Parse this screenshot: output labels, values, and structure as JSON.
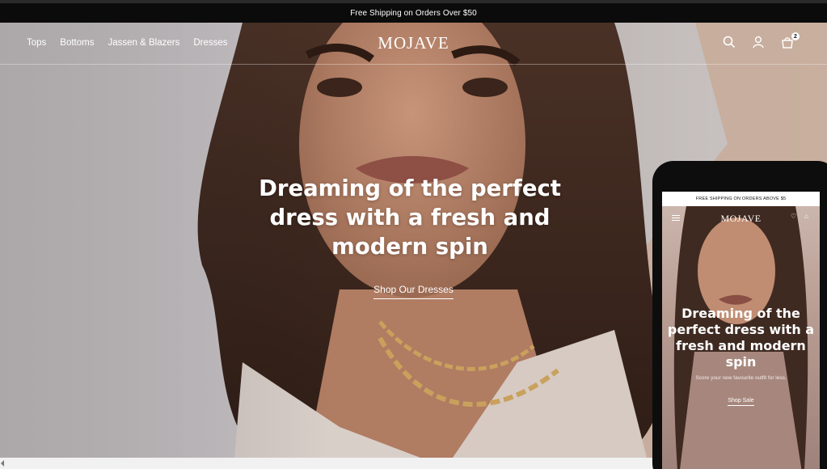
{
  "announcement": {
    "text": "Free Shipping on Orders Over $50"
  },
  "header": {
    "brand": "MOJAVE",
    "nav": [
      {
        "label": "Tops"
      },
      {
        "label": "Bottoms"
      },
      {
        "label": "Jassen & Blazers"
      },
      {
        "label": "Dresses"
      }
    ],
    "icons": [
      "search-icon",
      "account-icon",
      "cart-icon"
    ],
    "cart_count": "2"
  },
  "hero": {
    "headline": "Dreaming of the perfect dress with a fresh and modern spin",
    "cta": "Shop Our Dresses"
  },
  "phone": {
    "announcement": "FREE SHIPPING ON ORDERS ABOVE $5",
    "brand": "MOJAVE",
    "headline": "Dreaming of the perfect dress with a fresh and modern spin",
    "subtext": "Score your new favourite outfit for less.",
    "cta": "Shop Sale"
  },
  "colors": {
    "announcement_bg": "#0b0b0b",
    "text_light": "#ffffff",
    "phone_frame": "#0d0d0d"
  }
}
